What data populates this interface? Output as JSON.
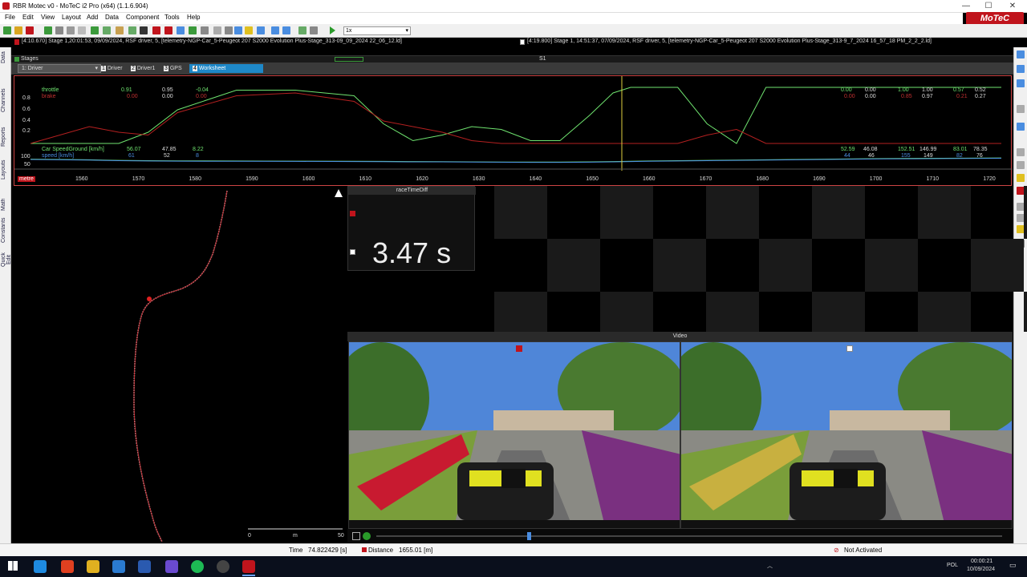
{
  "window": {
    "title": "RBR Motec v0 - MoTeC i2 Pro (x64) (1.1.6.904)",
    "logo_text": "MoTeC",
    "min_glyph": "—",
    "max_glyph": "☐",
    "close_glyph": "✕"
  },
  "menu": [
    "File",
    "Edit",
    "View",
    "Layout",
    "Add",
    "Data",
    "Component",
    "Tools",
    "Help"
  ],
  "toolbar": {
    "zoom_value": "1x"
  },
  "files": {
    "left": "[4:10.670] Stage 1,20:01:53, 09/09/2024, RSF driver, 5,  [telemetry-NGP-Car_5-Peugeot 207 S2000 Evolution Plus-Stage_313-09_09_2024 22_06_12.ld]",
    "right": "[4:19.800] Stage 1, 14:51:37, 07/09/2024, RSF driver, 5,  [telemetry-NGP-Car_5-Peugeot 207 S2000 Evolution Plus-Stage_313-9_7_2024 16_57_18 PM_2_2_2.ld]"
  },
  "left_tabs": [
    "Data",
    "Channels",
    "Reports",
    "Layouts",
    "Math",
    "Constants",
    "Quick Edit"
  ],
  "stages": {
    "label": "Stages",
    "marker": "S1"
  },
  "worksheet": {
    "combo": "1: Driver",
    "tabs": [
      {
        "num": "1",
        "label": "Driver"
      },
      {
        "num": "2",
        "label": "Driver1"
      },
      {
        "num": "3",
        "label": "GPS"
      },
      {
        "num": "4",
        "label": "Worksheet"
      }
    ]
  },
  "graph": {
    "channels_top": {
      "throttle_label": "throttle",
      "brake_label": "brake"
    },
    "cursor_vals_top": {
      "throttle": [
        "0.91",
        "0.95",
        "-0.04"
      ],
      "brake": [
        "0.00",
        "0.00",
        "0.00"
      ]
    },
    "stats_top": {
      "throttle": [
        "0.00",
        "0.00",
        "1.00",
        "1.00",
        "0.57",
        "0.52"
      ],
      "brake": [
        "0.00",
        "0.00",
        "0.85",
        "0.97",
        "0.21",
        "0.27"
      ]
    },
    "y_ticks_top": [
      "0.8",
      "0.6",
      "0.4",
      "0.2"
    ],
    "channels_bottom": {
      "speedground_label": "Car SpeedGround [km/h]",
      "speed_label": "speed [km/h]"
    },
    "cursor_vals_bottom": {
      "speedground": [
        "56.07",
        "47.85",
        "8.22"
      ],
      "speed": [
        "61",
        "52",
        "8"
      ]
    },
    "stats_bottom": {
      "speedground": [
        "52.59",
        "46.08",
        "152.51",
        "146.99",
        "83.01",
        "78.35"
      ],
      "speed": [
        "44",
        "46",
        "155",
        "149",
        "82",
        "76"
      ]
    },
    "y_ticks_bottom": [
      "100",
      "50"
    ],
    "x_unit": "metre",
    "x_ticks": [
      "1560",
      "1570",
      "1580",
      "1590",
      "1600",
      "1610",
      "1620",
      "1630",
      "1640",
      "1650",
      "1660",
      "1670",
      "1680",
      "1690",
      "1700",
      "1710",
      "1720"
    ]
  },
  "chart_data": {
    "type": "line",
    "xlabel": "metre",
    "x": [
      1556,
      1566,
      1571,
      1576,
      1581,
      1591,
      1601,
      1611,
      1616,
      1621,
      1626,
      1631,
      1636,
      1641,
      1646,
      1651,
      1655,
      1658,
      1661,
      1666,
      1671,
      1676,
      1681,
      1686,
      1691,
      1696,
      1701,
      1711,
      1721
    ],
    "series": [
      {
        "name": "throttle",
        "color": "#6fe36f",
        "values": [
          0.0,
          0.0,
          0.0,
          0.2,
          0.6,
          0.95,
          0.95,
          0.85,
          0.35,
          0.05,
          0.15,
          0.3,
          0.25,
          0.05,
          0.05,
          0.5,
          0.9,
          1.0,
          1.0,
          1.0,
          0.35,
          0.0,
          1.0,
          1.0,
          1.0,
          1.0,
          1.0,
          1.0,
          1.0
        ]
      },
      {
        "name": "brake",
        "color": "#b42020",
        "values": [
          0.0,
          0.3,
          0.2,
          0.15,
          0.55,
          0.85,
          0.9,
          0.75,
          0.4,
          0.3,
          0.2,
          0.05,
          0.0,
          0.0,
          0.0,
          0.0,
          0.0,
          0.0,
          0.0,
          0.0,
          0.15,
          0.25,
          0.0,
          0.0,
          0.0,
          0.0,
          0.0,
          0.0,
          0.0
        ]
      },
      {
        "name": "Car SpeedGround [km/h]",
        "color": "#6fe36f",
        "values": [
          66,
          62,
          58,
          56,
          55,
          54,
          53,
          52,
          51,
          50,
          49,
          48,
          47,
          47,
          47,
          48,
          50,
          52,
          54,
          56,
          58,
          60,
          62,
          64,
          66,
          68,
          70,
          72,
          74
        ]
      },
      {
        "name": "speed [km/h]",
        "color": "#4a8de0",
        "values": [
          64,
          60,
          56,
          54,
          53,
          52,
          51,
          50,
          49,
          48,
          48,
          47,
          46,
          45,
          45,
          46,
          48,
          50,
          52,
          54,
          56,
          58,
          60,
          62,
          64,
          66,
          68,
          70,
          72
        ]
      }
    ]
  },
  "race_time_diff": {
    "title": "raceTimeDiff",
    "value": "3.47 s"
  },
  "video": {
    "title": "Video"
  },
  "map_scale": {
    "zero": "0",
    "unit": "m",
    "max": "50"
  },
  "status": {
    "time_label": "Time",
    "time_value": "74.822429 [s]",
    "distance_label": "Distance",
    "distance_value": "1655.01 [m]",
    "activation": "Not Activated"
  },
  "tray": {
    "lang": "POL",
    "time": "00:00:21",
    "date": "10/09/2024"
  }
}
